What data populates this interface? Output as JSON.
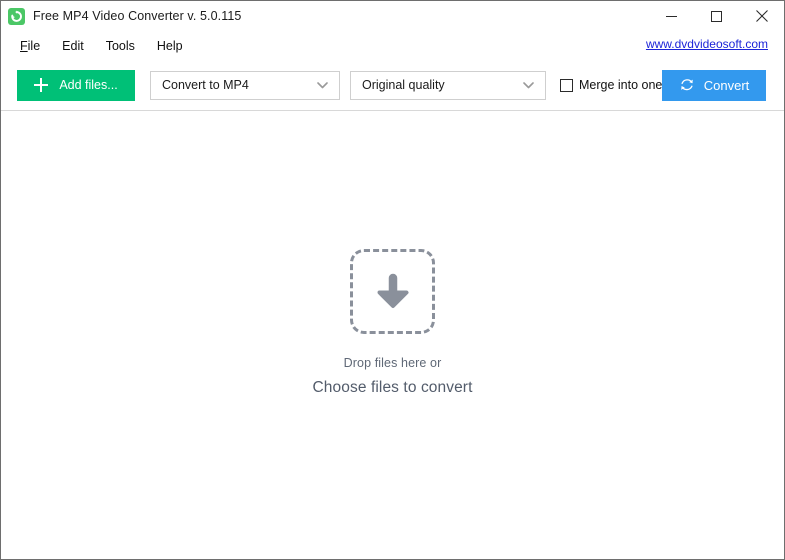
{
  "window": {
    "title": "Free MP4 Video Converter v. 5.0.115",
    "app_icon": "refresh-circle-icon",
    "controls": {
      "minimize": "minimize-icon",
      "maximize": "maximize-icon",
      "close": "close-icon"
    }
  },
  "menubar": {
    "items": [
      {
        "label": "File",
        "accel": "F",
        "rest": "ile"
      },
      {
        "label": "Edit",
        "accel": "",
        "rest": "Edit"
      },
      {
        "label": "Tools",
        "accel": "",
        "rest": "Tools"
      },
      {
        "label": "Help",
        "accel": "",
        "rest": "Help"
      }
    ],
    "link": "www.dvdvideosoft.com"
  },
  "toolbar": {
    "add_files_label": "Add files...",
    "add_files_icon": "plus-icon",
    "format_dropdown": {
      "selected": "Convert to MP4",
      "icon": "chevron-down-icon"
    },
    "quality_dropdown": {
      "selected": "Original quality",
      "icon": "chevron-down-icon"
    },
    "merge_checkbox": {
      "label": "Merge into one file",
      "checked": false
    },
    "convert_label": "Convert",
    "convert_icon": "refresh-icon"
  },
  "dropzone": {
    "icon": "download-arrow-icon",
    "line1": "Drop files here or",
    "line2": "Choose files to convert"
  },
  "colors": {
    "accent_green": "#00c077",
    "accent_blue": "#3399ee",
    "link_blue": "#1c24d8",
    "dropzone_gray": "#8a909b",
    "text_primary": "#1b1b1b"
  }
}
